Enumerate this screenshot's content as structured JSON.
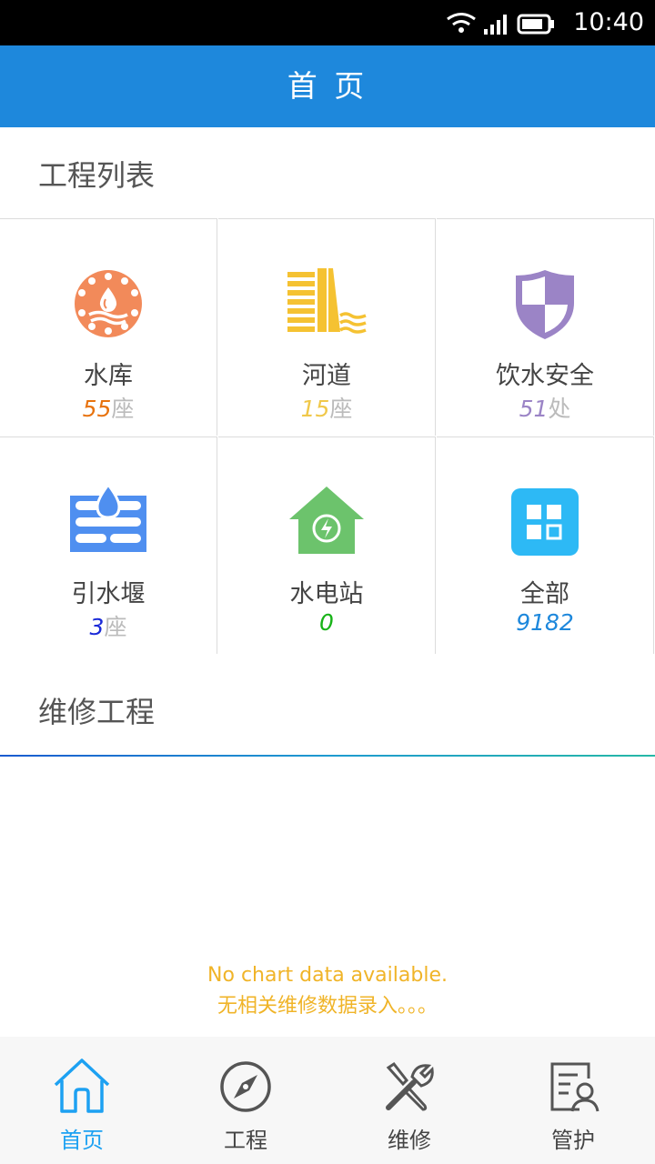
{
  "status_bar": {
    "time": "10:40",
    "icons": [
      "wifi-icon",
      "signal-icon",
      "battery-icon"
    ]
  },
  "header": {
    "title": "首 页"
  },
  "projects": {
    "title": "工程列表",
    "items": [
      {
        "name": "水库",
        "count": "55",
        "unit": "座",
        "count_color": "#e8730e",
        "icon": "reservoir-icon"
      },
      {
        "name": "河道",
        "count": "15",
        "unit": "座",
        "count_color": "#f0c84a",
        "icon": "river-icon"
      },
      {
        "name": "饮水安全",
        "count": "51",
        "unit": "处",
        "count_color": "#9b84c6",
        "icon": "shield-icon"
      },
      {
        "name": "引水堰",
        "count": "3",
        "unit": "座",
        "count_color": "#1a2ad8",
        "icon": "weir-icon"
      },
      {
        "name": "水电站",
        "count": "0",
        "unit": "",
        "count_color": "#18b318",
        "icon": "hydropower-icon"
      },
      {
        "name": "全部",
        "count": "9182",
        "unit": "",
        "count_color": "#1e88dc",
        "icon": "grid-icon"
      }
    ]
  },
  "maintenance": {
    "title": "维修工程",
    "no_data_line1": "No chart data available.",
    "no_data_line2": "无相关维修数据录入。。。"
  },
  "tabbar": {
    "items": [
      {
        "label": "首页",
        "icon": "home-icon",
        "active": true
      },
      {
        "label": "工程",
        "icon": "compass-icon",
        "active": false
      },
      {
        "label": "维修",
        "icon": "tools-icon",
        "active": false
      },
      {
        "label": "管护",
        "icon": "profile-doc-icon",
        "active": false
      }
    ]
  },
  "colors": {
    "accent": "#1e88dc",
    "active_tab": "#1da1f2",
    "no_data_text": "#f0b428"
  }
}
